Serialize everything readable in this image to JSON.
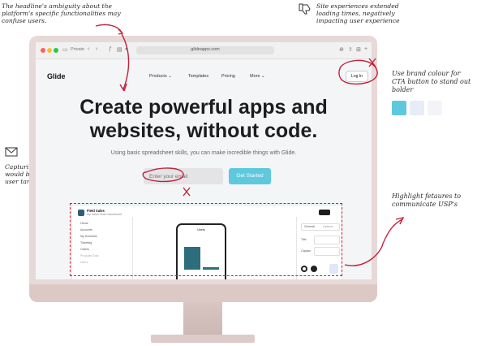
{
  "annotations": {
    "headline_note": "The headline's ambiguity about the platform's specific functionalities may confuse users.",
    "loading_note": "Site experiences extended loading times, negatively impacting user experience",
    "cta_note": "Use brand colour for CTA button to stand out bolder",
    "email_note": "Capturing work emails would be a better fit as per user targets",
    "features_note": "Highlight fetaures to communicate USP's"
  },
  "browser": {
    "tab_label": "Private",
    "url": "glideapps.com"
  },
  "site": {
    "logo": "Glide",
    "nav": [
      "Products",
      "Templates",
      "Pricing",
      "More"
    ],
    "login_label": "Log In",
    "hero_title_line1": "Create powerful apps and",
    "hero_title_line2": "websites, without code.",
    "hero_subtitle": "Using basic spreadsheet skills, you can make incredible things with Glide.",
    "email_placeholder": "Enter your email",
    "cta_label": "Get Started"
  },
  "preview": {
    "app_name": "Field Sales",
    "app_desc": "My Sales Team Dashboard",
    "sidebar_items": [
      "Home",
      "Accounts",
      "My Schedule",
      "Ticketing",
      "Orders",
      "Products Sold",
      "Users"
    ],
    "screen_label": "Users",
    "panel_tabs": [
      "General",
      "Options"
    ],
    "panel_fields": [
      "Title",
      "Caption"
    ]
  },
  "colors": {
    "cta": "#5ec8dd",
    "swatches": [
      "#5ec8dd",
      "#e6ecf8",
      "#f2f4f8"
    ],
    "annotation_red": "#c4213a"
  }
}
